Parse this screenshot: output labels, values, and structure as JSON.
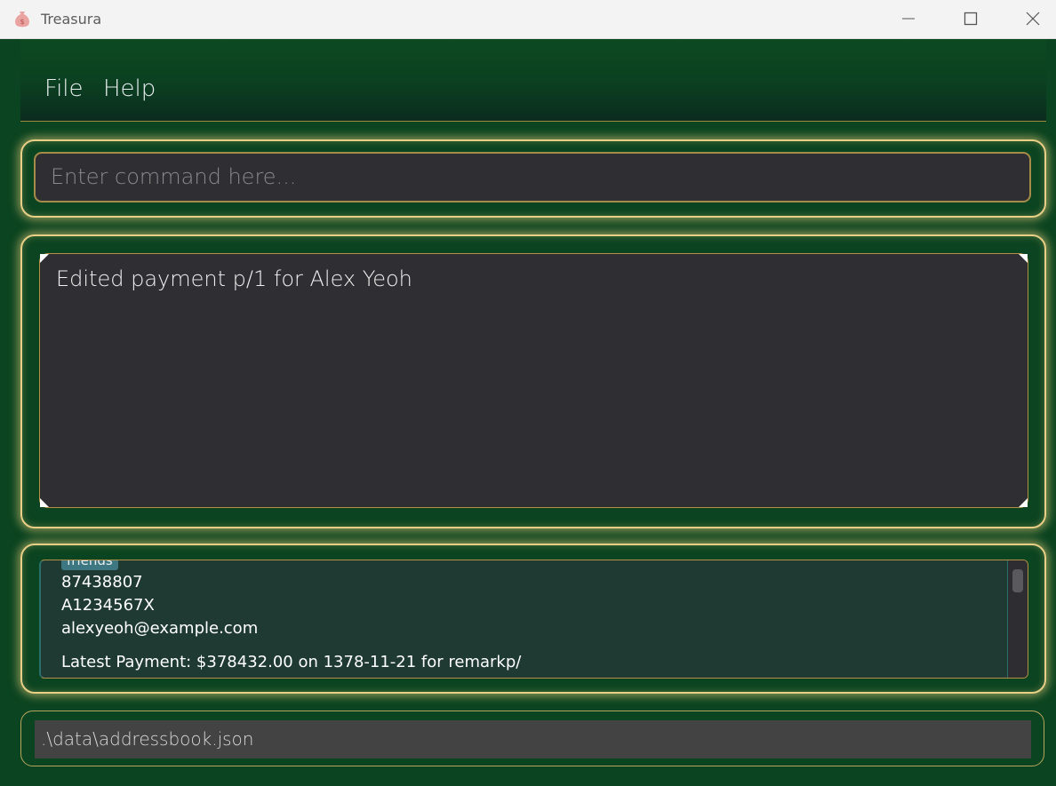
{
  "window": {
    "title": "Treasura",
    "app_icon": "money-bag-icon",
    "controls": [
      "minimize-icon",
      "maximize-icon",
      "close-icon"
    ]
  },
  "menu": {
    "file_label": "File",
    "help_label": "Help"
  },
  "command_box": {
    "placeholder": "Enter command here..."
  },
  "result_display": {
    "message": "Edited payment p/1 for Alex Yeoh"
  },
  "person_card": {
    "tag": "friends",
    "phone": "87438807",
    "nric": "A1234567X",
    "email": "alexyeoh@example.com",
    "latest_payment": "Latest Payment: $378432.00 on 1378-11-21 for remarkp/"
  },
  "status_bar": {
    "file_path": ".\\data\\addressbook.json"
  },
  "colors": {
    "background": "#0b4420",
    "panel_border": "#e8cf86",
    "input_background": "#2f2f33",
    "card_background": "#1e3a33",
    "tag_background": "#3d7782"
  }
}
